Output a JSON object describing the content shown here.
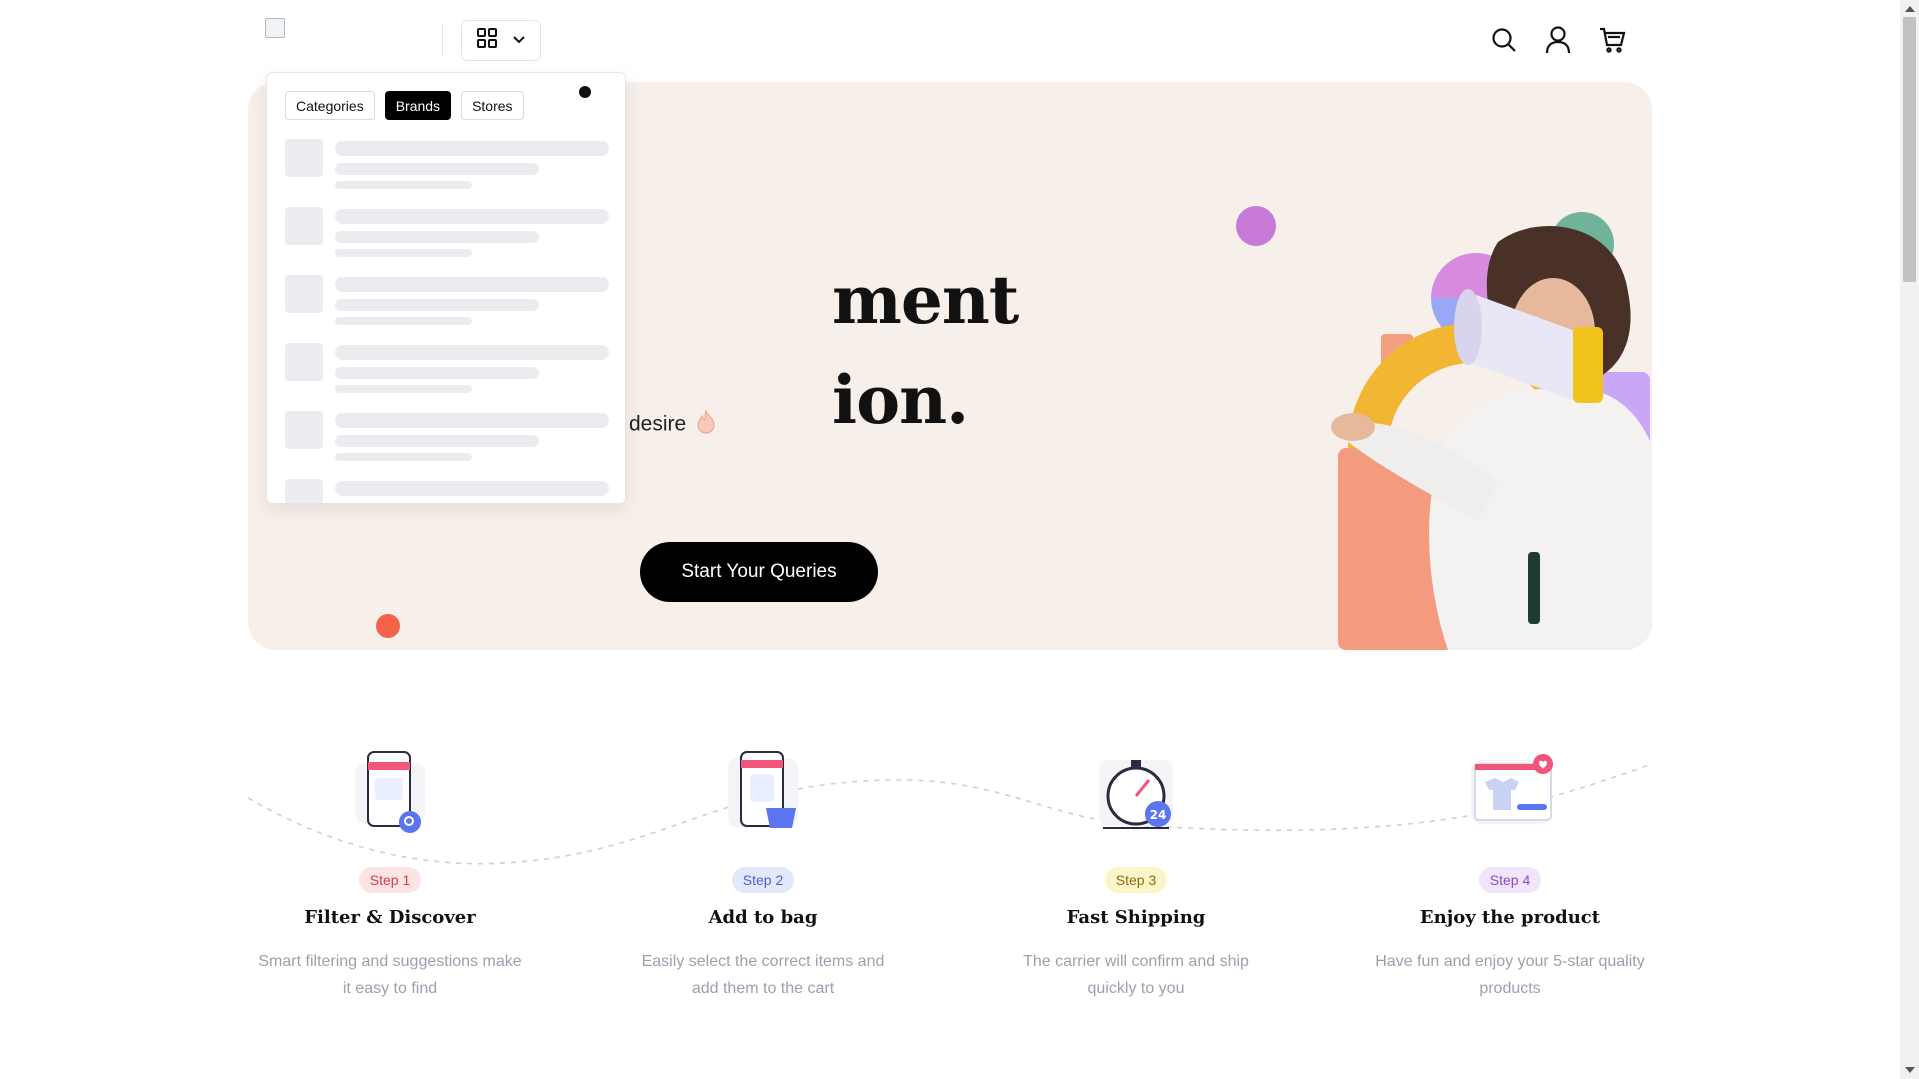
{
  "header": {
    "logo_alt": "logo",
    "icons": [
      "grid-icon",
      "chevron-down-icon",
      "search-icon",
      "user-icon",
      "cart-icon"
    ]
  },
  "dropdown": {
    "tabs": [
      {
        "label": "Categories",
        "active": false
      },
      {
        "label": "Brands",
        "active": true
      },
      {
        "label": "Stores",
        "active": false
      }
    ]
  },
  "hero": {
    "title_line1": "ment",
    "title_line2": "ion.",
    "subtitle": "desire",
    "cta": "Start Your Queries"
  },
  "steps": [
    {
      "badge": "Step 1",
      "title": "Filter & Discover",
      "description": "Smart filtering and suggestions make it easy to find",
      "badge_bg": "#fde4e4",
      "badge_color": "#d3404a"
    },
    {
      "badge": "Step 2",
      "title": "Add to bag",
      "description": "Easily select the correct items and add them to the cart",
      "badge_bg": "#e4e8fb",
      "badge_color": "#4d5fd6"
    },
    {
      "badge": "Step 3",
      "title": "Fast Shipping",
      "description": "The carrier will confirm and ship quickly to you",
      "badge_bg": "#fdf5c9",
      "badge_color": "#8a6d0b"
    },
    {
      "badge": "Step 4",
      "title": "Enjoy the product",
      "description": "Have fun and enjoy your 5-star quality products",
      "badge_bg": "#f2e5fb",
      "badge_color": "#8b4bc4"
    }
  ]
}
